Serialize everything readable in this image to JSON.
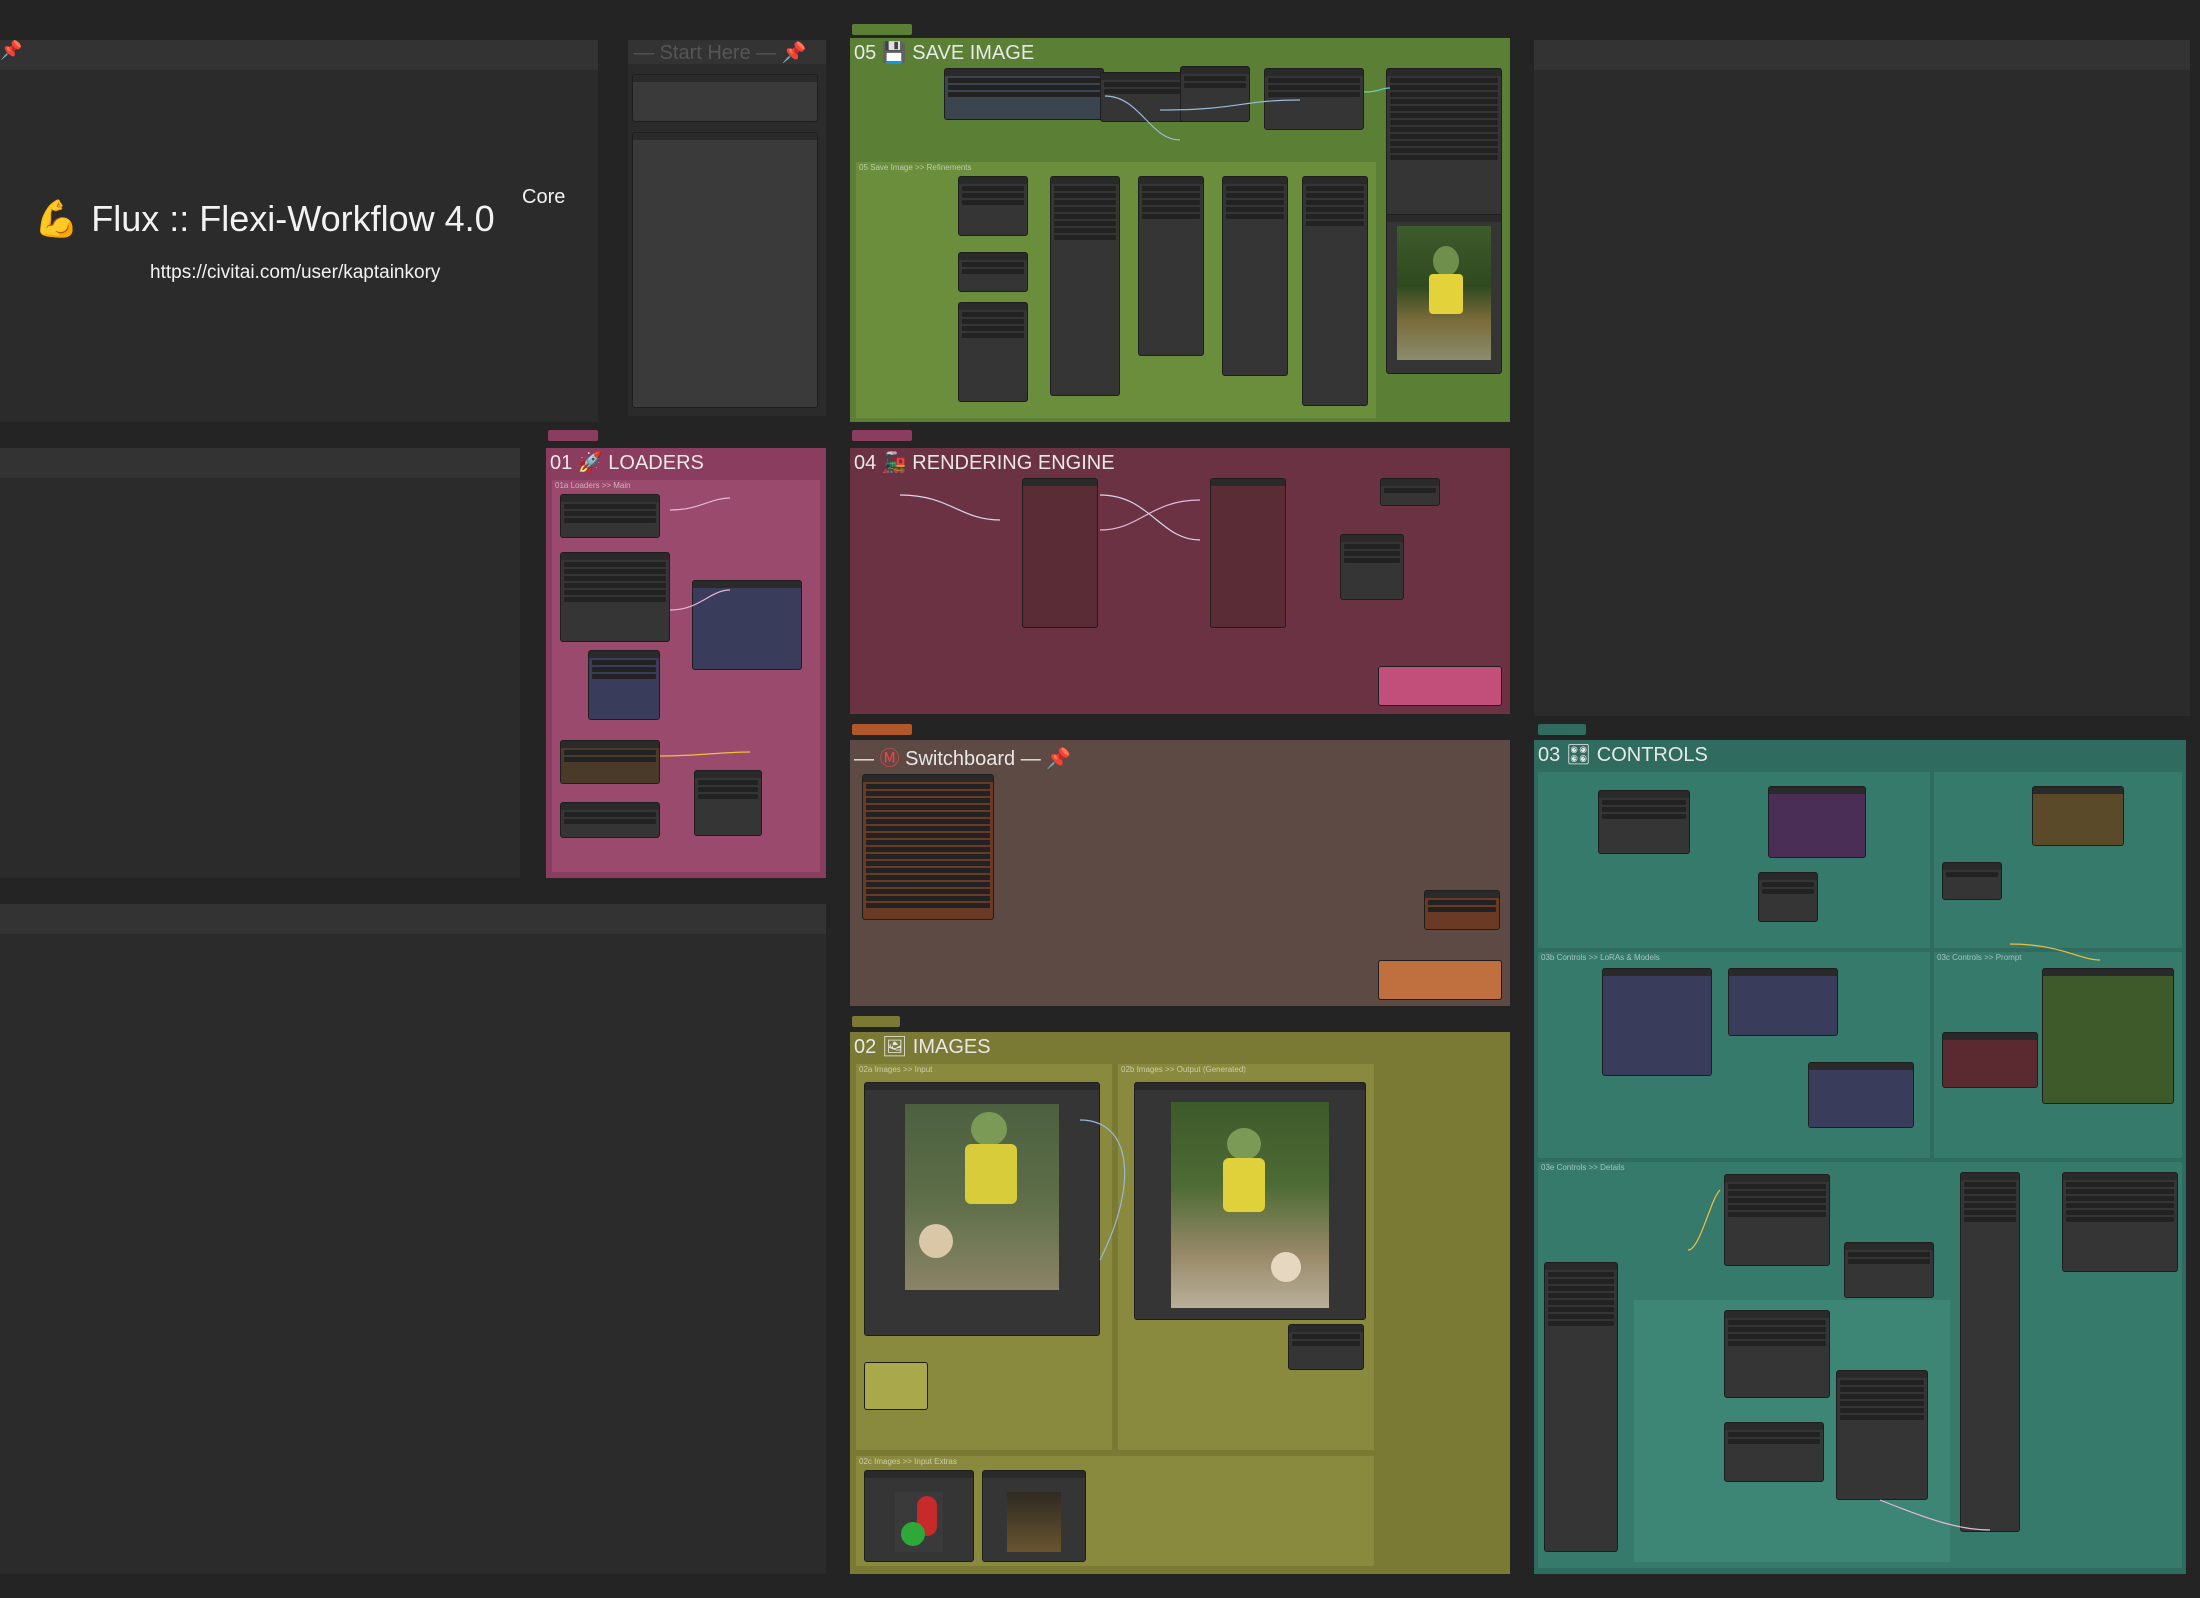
{
  "canvas": {
    "background": "#242424"
  },
  "title_card": {
    "icon": "flexed-biceps-icon",
    "icon_glyph": "💪",
    "title": "Flux :: Flexi-Workflow 4.0",
    "badge": "Core",
    "url": "https://civitai.com/user/kaptainkory"
  },
  "start_here": {
    "title": "Start Here",
    "pin_glyph": "📌",
    "dash": "—"
  },
  "groups": {
    "save_image": {
      "number": "05",
      "icon_glyph": "💾",
      "label": "SAVE IMAGE",
      "color": "#5b7f35",
      "sub_refinements": "05 Save Image >> Refinements"
    },
    "loaders": {
      "number": "01",
      "icon_glyph": "🚀",
      "label": "LOADERS",
      "color": "#8a3d5e",
      "sub_main": "01a Loaders >> Main"
    },
    "rendering_engine": {
      "number": "04",
      "icon_glyph": "🚂",
      "label": "RENDERING ENGINE",
      "color": "#6b3243"
    },
    "switchboard": {
      "icon_glyph": "Ⓜ",
      "label": "Switchboard",
      "pin_glyph": "📌",
      "dash": "—",
      "color": "#5e4a44"
    },
    "controls": {
      "number": "03",
      "icon_glyph": "🎛",
      "label": "CONTROLS",
      "color": "#2f6b5e",
      "sub_lora": "03b Controls >> LoRAs & Models",
      "sub_prompt": "03c Controls >> Prompt",
      "sub_details": "03e Controls >> Details"
    },
    "images": {
      "number": "02",
      "icon_glyph": "🖼",
      "label": "IMAGES",
      "color": "#7b7a35",
      "sub_input": "02a Images >> Input",
      "sub_output": "02b Images >> Output (Generated)",
      "sub_extras": "02c Images >> Input Extras"
    }
  },
  "colors": {
    "save": "#6a8a3a",
    "loaders": "#9a4a6c",
    "render": "#7a3a4f",
    "switch": "#6e5448",
    "controls": "#357a6b",
    "images": "#8a8a3e"
  }
}
